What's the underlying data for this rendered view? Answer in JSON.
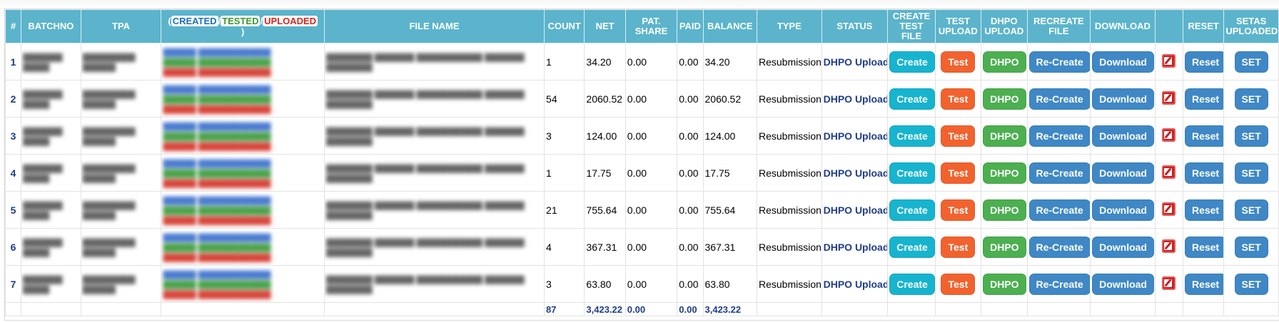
{
  "headers": {
    "idx": "#",
    "batchno": "BATCHNO",
    "tpa": "TPA",
    "legend_created": "CREATED",
    "legend_tested": "TESTED",
    "legend_uploaded": "UPLOADED",
    "legend_sep": "/",
    "legend_close": ")",
    "legend_open": "(",
    "file_name": "FILE NAME",
    "count": "COUNT",
    "net": "NET",
    "pat_share": "PAT. SHARE",
    "paid": "PAID",
    "balance": "BALANCE",
    "type": "TYPE",
    "status": "STATUS",
    "create_test_file": "CREATE TEST FILE",
    "test_upload": "TEST UPLOAD",
    "dhpo_upload": "DHPO UPLOAD",
    "recreate_file": "RECREATE FILE",
    "download": "DOWNLOAD",
    "blank": "",
    "reset": "RESET",
    "setas_uploaded": "SETAS UPLOADED"
  },
  "buttons": {
    "create": "Create",
    "test": "Test",
    "dhpo": "DHPO",
    "recreate": "Re-Create",
    "download": "Download",
    "reset": "Reset",
    "set": "SET"
  },
  "rows": [
    {
      "idx": "1",
      "count": "1",
      "net": "34.20",
      "pat_share": "0.00",
      "paid": "0.00",
      "balance": "34.20",
      "type": "Resubmission",
      "status": "DHPO Uploaded"
    },
    {
      "idx": "2",
      "count": "54",
      "net": "2060.52",
      "pat_share": "0.00",
      "paid": "0.00",
      "balance": "2060.52",
      "type": "Resubmission",
      "status": "DHPO Uploaded"
    },
    {
      "idx": "3",
      "count": "3",
      "net": "124.00",
      "pat_share": "0.00",
      "paid": "0.00",
      "balance": "124.00",
      "type": "Resubmission",
      "status": "DHPO Uploaded"
    },
    {
      "idx": "4",
      "count": "1",
      "net": "17.75",
      "pat_share": "0.00",
      "paid": "0.00",
      "balance": "17.75",
      "type": "Resubmission",
      "status": "DHPO Uploaded"
    },
    {
      "idx": "5",
      "count": "21",
      "net": "755.64",
      "pat_share": "0.00",
      "paid": "0.00",
      "balance": "755.64",
      "type": "Resubmission",
      "status": "DHPO Uploaded"
    },
    {
      "idx": "6",
      "count": "4",
      "net": "367.31",
      "pat_share": "0.00",
      "paid": "0.00",
      "balance": "367.31",
      "type": "Resubmission",
      "status": "DHPO Uploaded"
    },
    {
      "idx": "7",
      "count": "3",
      "net": "63.80",
      "pat_share": "0.00",
      "paid": "0.00",
      "balance": "63.80",
      "type": "Resubmission",
      "status": "DHPO Uploaded"
    }
  ],
  "totals": {
    "count": "87",
    "net": "3,423.22",
    "pat_share": "0.00",
    "paid": "0.00",
    "balance": "3,423.22"
  },
  "icons": {
    "edit": "edit-icon"
  },
  "colors": {
    "header_bg": "#5bb4cc",
    "create": "#17b4cf",
    "test": "#f2622e",
    "dhpo": "#4caf50",
    "blue_btn": "#3f88c5",
    "status_text": "#1f3c88"
  }
}
